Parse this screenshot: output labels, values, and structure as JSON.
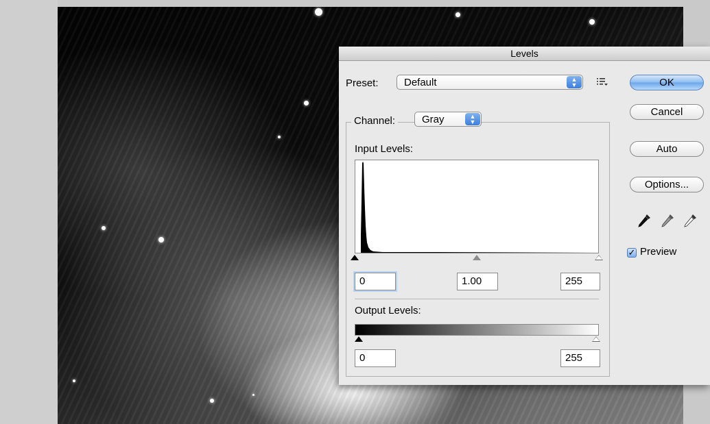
{
  "dialog": {
    "title": "Levels",
    "preset": {
      "label": "Preset:",
      "value": "Default"
    },
    "channel": {
      "label": "Channel:",
      "value": "Gray"
    },
    "input_levels": {
      "label": "Input Levels:",
      "black": "0",
      "gamma": "1.00",
      "white": "255",
      "black_slider_fraction": 0.0,
      "gray_slider_fraction": 0.5,
      "white_slider_fraction": 1.0
    },
    "output_levels": {
      "label": "Output Levels:",
      "black": "0",
      "white": "255"
    },
    "buttons": {
      "ok": "OK",
      "cancel": "Cancel",
      "auto": "Auto",
      "options": "Options..."
    },
    "preview": {
      "label": "Preview",
      "checked": true
    }
  },
  "colors": {
    "default_button": "#6aa6ec",
    "stepper": "#3c7fe0",
    "dialog_bg": "#e9e9e9"
  },
  "icons": [
    "preset-menu-icon",
    "black-eyedropper-icon",
    "gray-eyedropper-icon",
    "white-eyedropper-icon",
    "checkmark-icon"
  ]
}
